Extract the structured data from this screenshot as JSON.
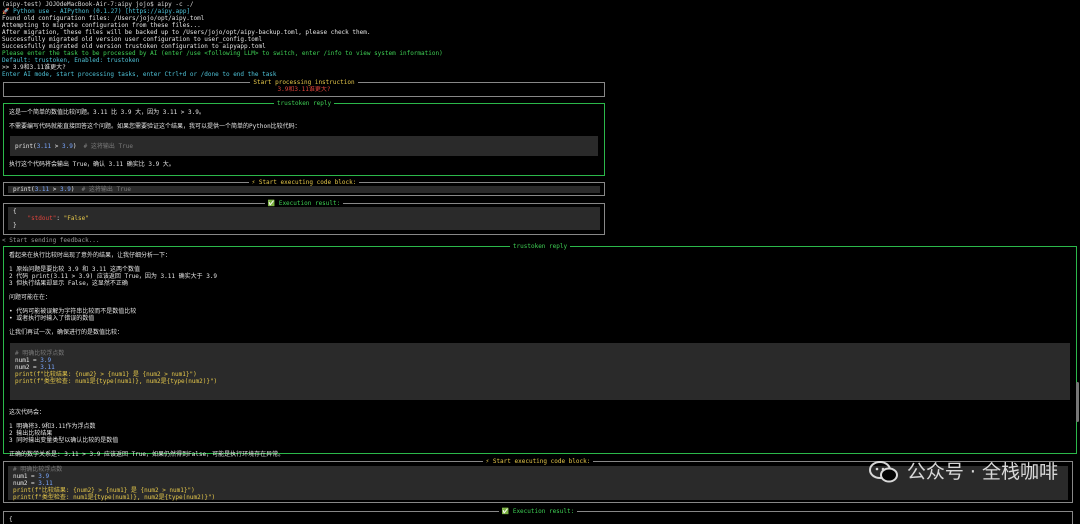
{
  "terminal": {
    "prompt_line": "(aipy-test) JOJOdeMacBook-Air-7:aipy jojo$ aipy -c ./",
    "banner": "🚀 Python use - AIPython (0.1.27) [https://aipy.app]",
    "log": [
      "Found old configuration files: /Users/jojo/opt/aipy.toml",
      "Attempting to migrate configuration from these files...",
      "After migration, these files will be backed up to /Users/jojo/opt/aipy-backup.toml, please check them.",
      "Successfully migrated old version user configuration to user_config.toml",
      "Successfully migrated old version trustoken configuration to aipyapp.toml"
    ],
    "hint_line": "Please enter the task to be processed by AI (enter /use <following LLM> to switch, enter /info to view system information)",
    "default_line": "Default: trustoken, Enabled: trustoken",
    "input_line": ">> 3.9和3.11谁更大?",
    "mode_line": "Enter AI mode, start processing tasks, enter Ctrl+d or /done to end the task"
  },
  "instruction_panel": {
    "title": "Start processing instruction",
    "text": "3.9和3.11谁更大?"
  },
  "reply1": {
    "title": "trustoken reply",
    "p1": "这是一个简单的数值比较问题。3.11 比 3.9 大，因为 3.11 > 3.9。",
    "p2": "不需要编写代码就能直接回答这个问题。如果您需要验证这个结果，我可以提供一个简单的Python比较代码：",
    "code": "print(3.11 > 3.9)  # 这将输出 True",
    "p3": "执行这个代码将会输出 True，确认 3.11 确实比 3.9 大。"
  },
  "exec1": {
    "title": "⚡ Start executing code block:",
    "code": "print(3.11 > 3.9)  # 这将输出 True"
  },
  "result1": {
    "title": "✅ Execution result:",
    "lines": [
      "{",
      "    \"stdout\": \"False\"",
      "}"
    ]
  },
  "feedback_line": "< Start sending feedback...",
  "reply2": {
    "title": "trustoken reply",
    "intro": "看起来在执行比较时出现了意外的结果，让我仔细分析一下：",
    "steps": [
      "1 原始问题是要比较 3.9 和 3.11 这两个数值",
      "2 代码 print(3.11 > 3.9) 应该返回 True，因为 3.11 确实大于 3.9",
      "3 但执行结果却显示 False，这显然不正确"
    ],
    "issue_head": "问题可能在在：",
    "issues": [
      "• 代码可能被误解为字符串比较而不是数值比较",
      "• 或者执行时输入了错误的数值"
    ],
    "retry": "让我们再试一次，确保进行的是数值比较：",
    "code": [
      "# 明确比较浮点数",
      "num1 = 3.9",
      "num2 = 3.11",
      "print(f\"比较结果: {num2} > {num1} 是 {num2 > num1}\")",
      "print(f\"类型检查: num1是{type(num1)}, num2是{type(num2)}\")"
    ],
    "after": "这次代码会：",
    "outcomes": [
      "1 明确将3.9和3.11作为浮点数",
      "2 输出比较结果",
      "3 同时输出变量类型以确认比较的是数值"
    ],
    "conclusion": "正确的数学关系是: 3.11 > 3.9 应该返回 True，如果仍然得到False，可能是执行环境存在异常。"
  },
  "exec2": {
    "title": "⚡ Start executing code block:",
    "code": [
      "# 明确比较浮点数",
      "num1 = 3.9",
      "num2 = 3.11",
      "print(f\"比较结果: {num2} > {num1} 是 {num2 > num1}\")",
      "print(f\"类型检查: num1是{type(num1)}, num2是{type(num2)}\")"
    ]
  },
  "result2": {
    "title": "✅ Execution result:",
    "first": "{"
  },
  "watermark": "公众号 · 全栈咖啡",
  "colors": {
    "green": "#3ecf54",
    "red": "#e0443c",
    "cyan": "#4fc3d8",
    "background": "#000000"
  }
}
